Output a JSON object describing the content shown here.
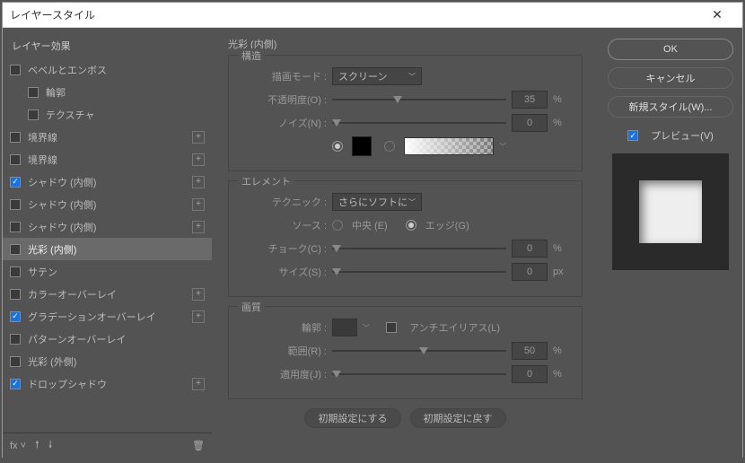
{
  "title": "レイヤースタイル",
  "panel_label": "レイヤー効果",
  "effects": [
    {
      "label": "ベベルとエンボス",
      "checked": false,
      "plus": false,
      "sub": false
    },
    {
      "label": "輪郭",
      "checked": false,
      "plus": false,
      "sub": true
    },
    {
      "label": "テクスチャ",
      "checked": false,
      "plus": false,
      "sub": true
    },
    {
      "label": "境界線",
      "checked": false,
      "plus": true,
      "sub": false
    },
    {
      "label": "境界線",
      "checked": false,
      "plus": true,
      "sub": false
    },
    {
      "label": "シャドウ (内側)",
      "checked": true,
      "plus": true,
      "sub": false
    },
    {
      "label": "シャドウ (内側)",
      "checked": false,
      "plus": true,
      "sub": false
    },
    {
      "label": "シャドウ (内側)",
      "checked": false,
      "plus": true,
      "sub": false
    },
    {
      "label": "光彩 (内側)",
      "checked": false,
      "plus": false,
      "sub": false,
      "selected": true
    },
    {
      "label": "サテン",
      "checked": false,
      "plus": false,
      "sub": false
    },
    {
      "label": "カラーオーバーレイ",
      "checked": false,
      "plus": true,
      "sub": false
    },
    {
      "label": "グラデーションオーバーレイ",
      "checked": true,
      "plus": true,
      "sub": false
    },
    {
      "label": "パターンオーバーレイ",
      "checked": false,
      "plus": false,
      "sub": false
    },
    {
      "label": "光彩 (外側)",
      "checked": false,
      "plus": false,
      "sub": false
    },
    {
      "label": "ドロップシャドウ",
      "checked": true,
      "plus": true,
      "sub": false
    }
  ],
  "section": "光彩 (内側)",
  "structure": {
    "legend": "構造",
    "blend_label": "描画モード :",
    "blend_value": "スクリーン",
    "opacity_label": "不透明度(O) :",
    "opacity_value": "35",
    "opacity_unit": "%",
    "noise_label": "ノイズ(N) :",
    "noise_value": "0",
    "noise_unit": "%"
  },
  "element": {
    "legend": "エレメント",
    "tech_label": "テクニック :",
    "tech_value": "さらにソフトに",
    "source_label": "ソース :",
    "center": "中央 (E)",
    "edge": "エッジ(G)",
    "choke_label": "チョーク(C) :",
    "choke_value": "0",
    "choke_unit": "%",
    "size_label": "サイズ(S) :",
    "size_value": "0",
    "size_unit": "px"
  },
  "quality": {
    "legend": "画質",
    "contour_label": "輪郭 :",
    "aa_label": "アンチエイリアス(L)",
    "range_label": "範囲(R) :",
    "range_value": "50",
    "range_unit": "%",
    "jitter_label": "適用度(J) :",
    "jitter_value": "0",
    "jitter_unit": "%"
  },
  "buttons": {
    "default1": "初期設定にする",
    "default2": "初期設定に戻す",
    "ok": "OK",
    "cancel": "キャンセル",
    "newstyle": "新規スタイル(W)...",
    "preview": "プレビュー(V)"
  }
}
